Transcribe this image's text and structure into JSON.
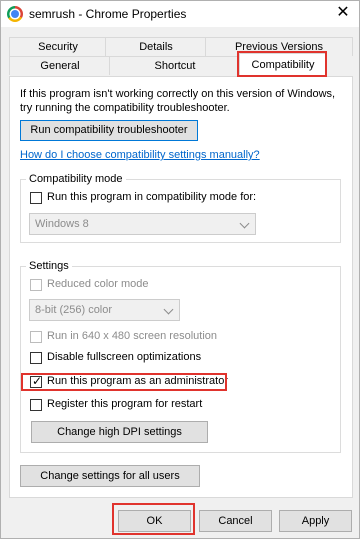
{
  "window": {
    "title": "semrush - Chrome Properties",
    "close_glyph": "✕"
  },
  "tabs_row1": [
    "Security",
    "Details",
    "Previous Versions"
  ],
  "tabs_row2": [
    "General",
    "Shortcut",
    "Compatibility"
  ],
  "active_tab": "Compatibility",
  "intro_text": "If this program isn't working correctly on this version of Windows, try running the compatibility troubleshooter.",
  "troubleshooter_button": "Run compatibility troubleshooter",
  "manual_link": "How do I choose compatibility settings manually?",
  "compat_mode": {
    "legend": "Compatibility mode",
    "checkbox_label": "Run this program in compatibility mode for:",
    "checked": false,
    "select_value": "Windows 8"
  },
  "settings": {
    "legend": "Settings",
    "reduced_color": {
      "label": "Reduced color mode",
      "checked": false,
      "disabled": true
    },
    "color_select": "8-bit (256) color",
    "res_640": {
      "label": "Run in 640 x 480 screen resolution",
      "checked": false,
      "disabled": true
    },
    "disable_fullscreen": {
      "label": "Disable fullscreen optimizations",
      "checked": false
    },
    "run_admin": {
      "label": "Run this program as an administrator",
      "checked": true
    },
    "register_restart": {
      "label": "Register this program for restart",
      "checked": false
    },
    "dpi_button": "Change high DPI settings"
  },
  "all_users_button": "Change settings for all users",
  "footer": {
    "ok": "OK",
    "cancel": "Cancel",
    "apply": "Apply"
  },
  "highlight_color": "#e0332d"
}
